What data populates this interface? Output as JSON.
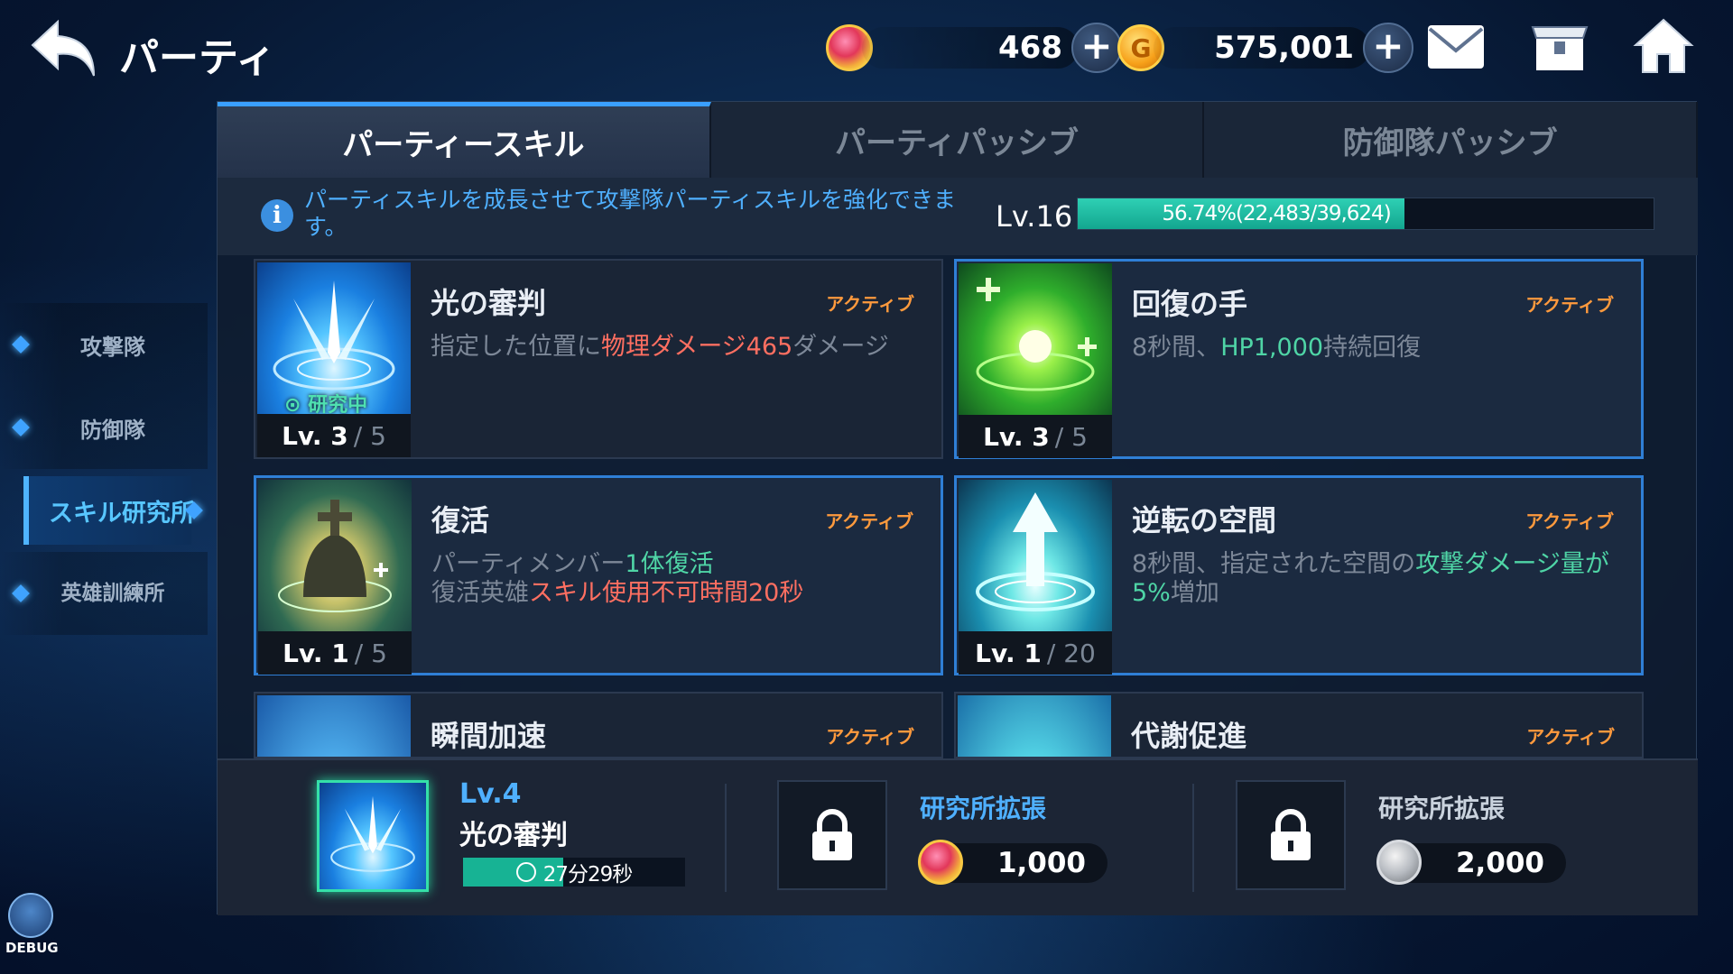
{
  "header": {
    "title": "パーティ",
    "gems": "468",
    "gold": "575,001",
    "plus": "+"
  },
  "sidenav": {
    "items": [
      {
        "label": "攻撃隊"
      },
      {
        "label": "防御隊"
      },
      {
        "label": "スキル研究所"
      },
      {
        "label": "英雄訓練所"
      }
    ]
  },
  "tabs": [
    {
      "label": "パーティースキル"
    },
    {
      "label": "パーティパッシブ"
    },
    {
      "label": "防御隊パッシブ"
    }
  ],
  "info": {
    "text": "パーティスキルを成長させて攻撃隊パーティスキルを強化できます。",
    "level": "Lv.16",
    "exp_text": "56.74%(22,483/39,624)",
    "exp_percent": 56.74
  },
  "skills": [
    {
      "name": "光の審判",
      "type": "アクティブ",
      "level": "Lv. 3",
      "max": "/ 5",
      "desc_a": "指定した位置に",
      "desc_b": "物理ダメージ465",
      "desc_c": "ダメージ",
      "status": "研究中"
    },
    {
      "name": "回復の手",
      "type": "アクティブ",
      "level": "Lv. 3",
      "max": "/ 5",
      "desc_a": "8秒間、",
      "desc_b": "HP1,000",
      "desc_c": "持続回復"
    },
    {
      "name": "復活",
      "type": "アクティブ",
      "level": "Lv. 1",
      "max": "/ 5",
      "desc_a": "パーティメンバー",
      "desc_b": "1体復活",
      "desc_c": "復活英雄",
      "desc_d": "スキル使用不可時間20秒"
    },
    {
      "name": "逆転の空間",
      "type": "アクティブ",
      "level": "Lv. 1",
      "max": "/ 20",
      "desc_a": "8秒間、指定された空間の",
      "desc_b": "攻撃ダメージ量が5%",
      "desc_c": "増加"
    },
    {
      "name": "瞬間加速",
      "type": "アクティブ"
    },
    {
      "name": "代謝促進",
      "type": "アクティブ"
    }
  ],
  "research": {
    "slot1_level": "Lv.4",
    "slot1_name": "光の審判",
    "slot1_timer": "27分29秒",
    "slot1_progress": 0.45,
    "slot2_title": "研究所拡張",
    "slot2_cost": "1,000",
    "slot3_title": "研究所拡張",
    "slot3_cost": "2,000"
  },
  "debug": "DEBUG",
  "colors": {
    "accent_blue": "#3aa0ff",
    "active_type": "#ff9a3d",
    "teal": "#17b394"
  }
}
